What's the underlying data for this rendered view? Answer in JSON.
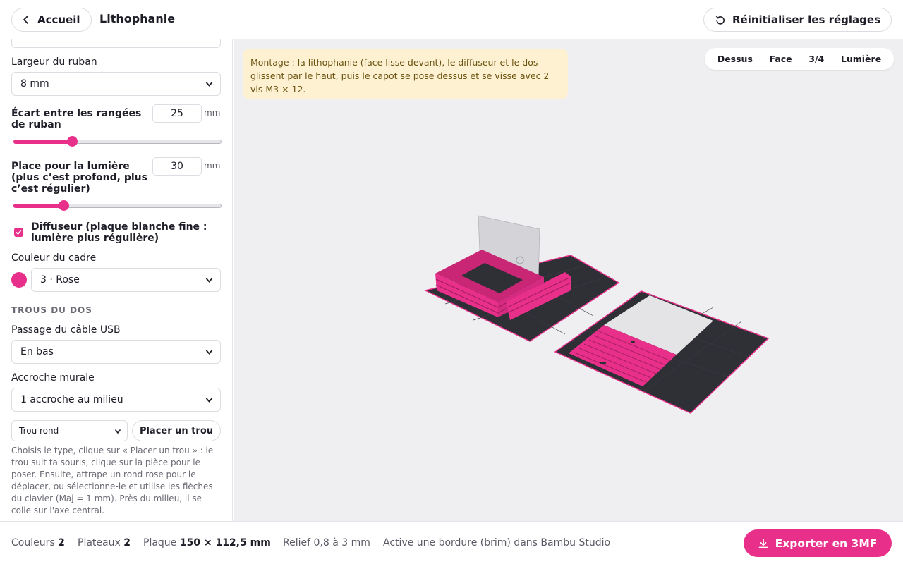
{
  "header": {
    "back_label": "Accueil",
    "title": "Lithophanie",
    "reset_label": "Réinitialiser les réglages"
  },
  "sidebar": {
    "ribbon_width": {
      "label": "Largeur du ruban",
      "value": "8 mm"
    },
    "row_gap": {
      "label": "Écart entre les rangées de ruban",
      "value": "25",
      "unit": "mm",
      "slider_fraction": 0.28
    },
    "light_space": {
      "label": "Place pour la lumière (plus c’est profond, plus c’est régulier)",
      "value": "30",
      "unit": "mm",
      "slider_fraction": 0.24
    },
    "diffuser": {
      "label": "Diffuseur (plaque blanche fine : lumière plus régulière)",
      "checked": true
    },
    "frame_color": {
      "label": "Couleur du cadre",
      "value": "3 · Rose",
      "swatch": "#e8308a"
    },
    "back_holes": {
      "section_title": "TROUS DU DOS",
      "usb": {
        "label": "Passage du câble USB",
        "value": "En bas"
      },
      "wall_hook": {
        "label": "Accroche murale",
        "value": "1 accroche au milieu"
      },
      "hole_type": "Trou rond",
      "place_hole_label": "Placer un trou",
      "help": "Choisis le type, clique sur « Placer un trou » : le trou suit ta souris, clique sur la pièce pour le poser. Ensuite, attrape un rond rose pour le déplacer, ou sélectionne-le et utilise les flèches du clavier (Maj = 1 mm). Près du milieu, il se colle sur l'axe central."
    }
  },
  "viewport": {
    "notice": "Montage : la lithophanie (face lisse devant), le diffuseur et le dos glissent par le haut, puis le capot se pose dessus et se visse avec 2 vis M3 × 12.",
    "views": [
      "Dessus",
      "Face",
      "3/4",
      "Lumière"
    ]
  },
  "footer": {
    "colors_label": "Couleurs",
    "colors_value": "2",
    "plates_label": "Plateaux",
    "plates_value": "2",
    "plate_label": "Plaque",
    "plate_value": "150 × 112,5 mm",
    "relief": "Relief 0,8 à 3 mm",
    "brim_hint": "Active une bordure (brim) dans Bambu Studio",
    "export_label": "Exporter en 3MF"
  },
  "colors": {
    "accent": "#e8308a",
    "plate": "#2f2f36",
    "notice_bg": "#fdf1d2"
  }
}
